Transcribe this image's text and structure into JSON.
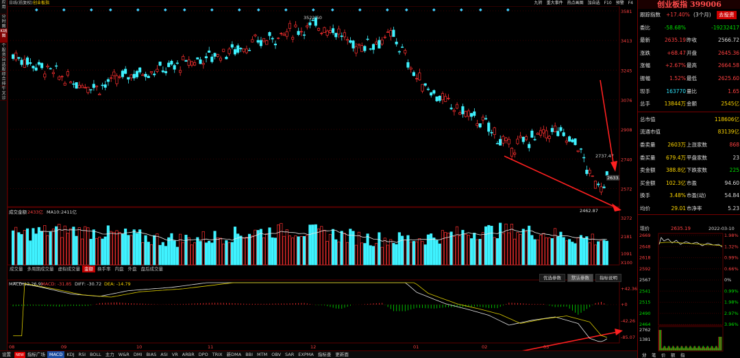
{
  "left_tabs": [
    "应用",
    "分时图",
    "K线图",
    "个股资料",
    "自选股",
    "综合排名",
    "牛叉诊断"
  ],
  "top": {
    "cycle": "日线(前复权)",
    "indicator": "创业板指",
    "buttons": [
      "九转",
      "重大事件",
      "热点画图",
      "加自选",
      "F10",
      "预警",
      "F4"
    ]
  },
  "kline": {
    "price_ticks": [
      "3581",
      "3413",
      "3245",
      "3076",
      "2908",
      "2740",
      "2572"
    ],
    "high_label": "3522.50",
    "low_label": "2462.87",
    "last_label": "2737.47",
    "last_close_tag": "2633.",
    "cursor_label": "2737.47"
  },
  "volume": {
    "title": "成交金额",
    "value": "2433亿",
    "ma10_label": "MA10:",
    "ma10": "2411亿",
    "ticks": [
      "3272",
      "2181",
      "1091",
      "X100"
    ]
  },
  "vol_tabs": [
    "成交量",
    "多周期成交量",
    "虚拟成交量",
    "金额",
    "换手率",
    "内盘",
    "外盘",
    "盘后成交量"
  ],
  "vol_tab_active": 3,
  "macd": {
    "params": "MACD(12,26,9)",
    "macd": "MACD: -31.85",
    "dif": "DIFF: -30.72",
    "dea": "DEA: -14.79",
    "ticks": [
      "+42.36",
      "+0",
      "-42.26",
      "-85.07"
    ],
    "buttons": [
      "优选参数",
      "默认参数",
      "指标说明"
    ]
  },
  "months": [
    "08",
    "09",
    "10",
    "11",
    "12",
    "01",
    "02",
    "03"
  ],
  "bottom_tabs": [
    "设置",
    "指标广场",
    "MACD",
    "KDJ",
    "RSI",
    "BOLL",
    "主力",
    "W&R",
    "DMI",
    "BIAS",
    "ASI",
    "VR",
    "ARBR",
    "DPO",
    "TRIX",
    "新DMA",
    "BBI",
    "MTM",
    "OBV",
    "SAR",
    "EXPMA",
    "指标查",
    "更新面"
  ],
  "bottom_new": "NEW",
  "bottom_active": 2,
  "right": {
    "title": "创业板指 399006",
    "rows": [
      {
        "l": "跟踪指数",
        "v": "+17.40%",
        "v2": "(3个月)",
        "btn": "去投资"
      },
      {
        "l": "委比",
        "v": "-58.68%",
        "l2": "",
        "v2": "-19232417"
      },
      {
        "l": "最新",
        "v": "2635.19",
        "l2": "昨收",
        "v2": "2566.72"
      },
      {
        "l": "涨跌",
        "v": "+68.47",
        "l2": "开盘",
        "v2": "2645.36"
      },
      {
        "l": "涨幅",
        "v": "+2.67%",
        "l2": "最高",
        "v2": "2664.58"
      },
      {
        "l": "振幅",
        "v": "1.52%",
        "l2": "最低",
        "v2": "2625.60"
      },
      {
        "l": "现手",
        "v": "163770",
        "l2": "量比",
        "v2": "1.65"
      },
      {
        "l": "总手",
        "v": "13844万",
        "l2": "金额",
        "v2": "2545亿"
      },
      {
        "l": "总市值",
        "v": "",
        "l2": "",
        "v2": "118606亿"
      },
      {
        "l": "流通市值",
        "v": "",
        "l2": "",
        "v2": "83139亿"
      },
      {
        "l": "委卖量",
        "v": "2603万",
        "l2": "上涨家数",
        "v2": "868"
      },
      {
        "l": "委买量",
        "v": "679.4万",
        "l2": "平盘家数",
        "v2": "23"
      },
      {
        "l": "卖金额",
        "v": "388.8亿",
        "l2": "下跌家数",
        "v2": "225"
      },
      {
        "l": "买金额",
        "v": "102.3亿",
        "l2": "市盈",
        "v2": "94.60"
      },
      {
        "l": "换手",
        "v": "3.48%",
        "l2": "市盈(动)",
        "v2": "54.84"
      },
      {
        "l": "均价",
        "v": "29.01",
        "l2": "市净率",
        "v2": "5.23"
      }
    ]
  },
  "mini": {
    "label": "现价",
    "price": "2635.19",
    "date": "2022-03-10",
    "left_ticks": [
      "2669",
      "2648",
      "2618",
      "2592",
      "2567",
      "2541",
      "2515",
      "2490",
      "2464"
    ],
    "right_ticks": [
      "1.98%",
      "1.32%",
      "0.99%",
      "0.66%",
      "0%",
      "0.99%",
      "1.98%",
      "2.97%",
      "3.96%"
    ],
    "vol_ticks": [
      "2762",
      "1381"
    ],
    "bottom_tabs": [
      "分",
      "笔",
      "价",
      "额",
      "指"
    ]
  },
  "colors": {
    "up": "#ff3030",
    "down": "#3ff2ff",
    "bg": "#000000",
    "grid": "#5a0000"
  }
}
